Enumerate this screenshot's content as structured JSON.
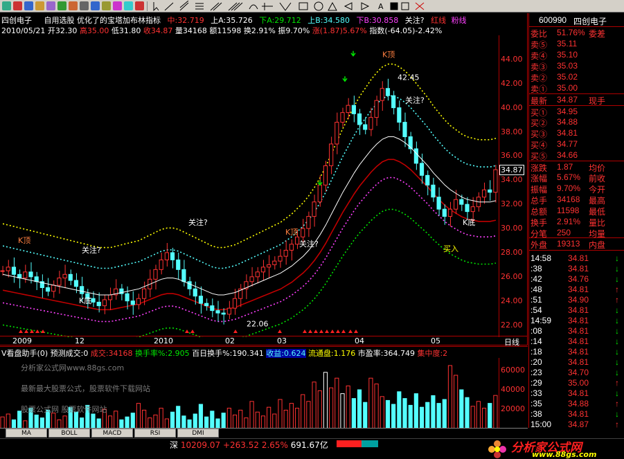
{
  "header": {
    "stock_name": "四创电子",
    "formula_line": "自用选股 优化了的宝塔加布林指标",
    "mid": "中:32.719",
    "upA": "上A:35.726",
    "downA": "下A:29.712",
    "upB": "上B:34.580",
    "downB": "下B:30.858",
    "focus": "关注?",
    "red_line": "红线",
    "pink_line": "粉线"
  },
  "info_line": {
    "date": "2010/05/21",
    "open": "开32.30",
    "high": "高35.00",
    "low": "低31.80",
    "close": "收34.87",
    "volume": "量34168",
    "amount": "额11598",
    "turnover": "换2.91%",
    "amplitude": "振9.70%",
    "change": "涨(1.87)5.67%",
    "index": "指数(-64.05)-2.42%"
  },
  "price_axis": [
    "44.00",
    "42.00",
    "40.00",
    "38.00",
    "36.00",
    "34.00",
    "32.00",
    "30.00",
    "28.00",
    "26.00",
    "24.00",
    "22.00"
  ],
  "price_current": "34.87",
  "date_axis": [
    "2009",
    "12",
    "2010",
    "02",
    "03",
    "04",
    "05"
  ],
  "date_axis_unit": "日线",
  "chart_labels": {
    "guanzhu": "关注?",
    "kdi": "K底",
    "kding": "K顶",
    "mairu": "买入",
    "low_mark": "22.06",
    "high_mark": "42.45"
  },
  "indicator_header": {
    "name": "V看盘助手(0)",
    "forecast": "预测成交:0",
    "volume": "成交:34168",
    "turnover": "换手率%:2.905",
    "turnover100": "百日换手%:190.341",
    "profit": "收益:0.624",
    "float": "流通盘:1.176",
    "pe": "市盈率:364.749",
    "conc": "集中度:2"
  },
  "volume_axis": [
    "60000",
    "40000",
    "20000"
  ],
  "watermarks": [
    "分析家公式网www.88gs.com",
    "最新最大股票公式，股票软件下载网站",
    "股票公式网 股票软件网站"
  ],
  "tabs": [
    "MA",
    "BOLL",
    "MACD",
    "RSI",
    "DMI"
  ],
  "status": {
    "market": "深",
    "index_value": "10209.07",
    "index_change": "+263.52",
    "index_pct": "2.65%",
    "turnover": "691.67亿"
  },
  "logo": {
    "text": "分析家公式网",
    "url": "www.88gs.com"
  },
  "right_panel": {
    "code": "600990",
    "name": "四创电子",
    "weibi_label": "委比",
    "weibi_value": "51.76%",
    "weicha_label": "委差",
    "sell": [
      {
        "label": "卖⑤",
        "price": "35.11"
      },
      {
        "label": "卖④",
        "price": "35.10"
      },
      {
        "label": "卖③",
        "price": "35.03"
      },
      {
        "label": "卖②",
        "price": "35.02"
      },
      {
        "label": "卖①",
        "price": "35.00"
      }
    ],
    "latest_label": "最新",
    "latest_value": "34.87",
    "xianshou": "现手",
    "buy": [
      {
        "label": "买①",
        "price": "34.95"
      },
      {
        "label": "买②",
        "price": "34.88"
      },
      {
        "label": "买③",
        "price": "34.81"
      },
      {
        "label": "买④",
        "price": "34.77"
      },
      {
        "label": "买⑤",
        "price": "34.66"
      }
    ],
    "stats": [
      {
        "l": "涨跌",
        "v": "1.87",
        "r": "均价"
      },
      {
        "l": "涨幅",
        "v": "5.67%",
        "r": "前收"
      },
      {
        "l": "振幅",
        "v": "9.70%",
        "r": "今开"
      },
      {
        "l": "总手",
        "v": "34168",
        "r": "最高"
      },
      {
        "l": "总额",
        "v": "11598",
        "r": "最低"
      },
      {
        "l": "换手",
        "v": "2.91%",
        "r": "量比"
      },
      {
        "l": "分笔",
        "v": "250",
        "r": "均量"
      }
    ],
    "waipan_label": "外盘",
    "waipan_value": "19313",
    "neipan_label": "内盘",
    "ticks": [
      {
        "t": "14:58",
        "p": "34.81",
        "d": "↓"
      },
      {
        "t": ":38",
        "p": "34.81",
        "d": "↓"
      },
      {
        "t": ":42",
        "p": "34.76",
        "d": "↓"
      },
      {
        "t": ":48",
        "p": "34.81",
        "d": "↑"
      },
      {
        "t": ":51",
        "p": "34.90",
        "d": "↑"
      },
      {
        "t": ":54",
        "p": "34.81",
        "d": "↓"
      },
      {
        "t": "14:59",
        "p": "34.81",
        "d": "↓"
      },
      {
        "t": ":08",
        "p": "34.81",
        "d": "↓"
      },
      {
        "t": ":14",
        "p": "34.81",
        "d": "↓"
      },
      {
        "t": ":18",
        "p": "34.81",
        "d": "↓"
      },
      {
        "t": ":20",
        "p": "34.81",
        "d": "↓"
      },
      {
        "t": ":23",
        "p": "34.70",
        "d": "↓"
      },
      {
        "t": ":29",
        "p": "35.00",
        "d": "↑"
      },
      {
        "t": ":33",
        "p": "34.81",
        "d": "↓"
      },
      {
        "t": ":35",
        "p": "34.88",
        "d": "↑"
      },
      {
        "t": ":38",
        "p": "34.81",
        "d": "↓"
      },
      {
        "t": "15:00",
        "p": "34.87",
        "d": "↑"
      }
    ]
  },
  "chart_data": {
    "type": "candlestick",
    "ylim": [
      21,
      46
    ],
    "close_series": [
      26.5,
      26.8,
      26.2,
      25.9,
      26.4,
      26.0,
      25.6,
      25.1,
      24.8,
      25.3,
      25.9,
      26.2,
      25.7,
      25.2,
      24.6,
      24.2,
      23.9,
      23.6,
      24.1,
      24.5,
      25.0,
      24.6,
      24.0,
      23.7,
      24.2,
      25.0,
      25.8,
      26.6,
      27.4,
      28.0,
      27.4,
      26.6,
      25.6,
      25.0,
      24.4,
      23.8,
      23.6,
      23.2,
      23.0,
      22.9,
      23.4,
      24.2,
      25.0,
      25.6,
      26.0,
      26.4,
      26.8,
      27.0,
      27.3,
      27.7,
      28.2,
      28.7,
      29.3,
      30.0,
      31.0,
      32.2,
      33.6,
      35.2,
      37.0,
      38.8,
      39.6,
      40.2,
      39.5,
      38.6,
      38.2,
      39.2,
      40.6,
      41.6,
      41.0,
      40.0,
      38.8,
      37.6,
      36.6,
      35.4,
      34.4,
      33.6,
      32.6,
      31.6,
      31.0,
      31.6,
      32.4,
      32.0,
      31.4,
      31.8,
      32.6,
      33.2,
      33.0,
      34.87
    ],
    "ma_series": [
      26.2,
      26.1,
      26.0,
      25.9,
      25.8,
      25.7,
      25.6,
      25.5,
      25.4,
      25.3,
      25.2,
      25.1,
      25.0,
      24.9,
      24.8,
      24.7,
      24.6,
      24.5,
      24.5,
      24.5,
      24.6,
      24.7,
      24.8,
      24.9,
      25.0,
      25.2,
      25.4,
      25.6,
      25.8,
      25.9,
      25.9,
      25.8,
      25.6,
      25.4,
      25.2,
      25.0,
      24.8,
      24.6,
      24.5,
      24.5,
      24.6,
      24.7,
      24.9,
      25.1,
      25.3,
      25.5,
      25.7,
      25.9,
      26.1,
      26.3,
      26.6,
      26.9,
      27.3,
      27.7,
      28.2,
      28.8,
      29.5,
      30.3,
      31.2,
      32.1,
      33.0,
      33.8,
      34.6,
      35.3,
      35.9,
      36.5,
      37.0,
      37.4,
      37.6,
      37.6,
      37.4,
      37.1,
      36.7,
      36.2,
      35.7,
      35.2,
      34.6,
      34.1,
      33.6,
      33.2,
      32.9,
      32.6,
      32.4,
      32.3,
      32.2,
      32.2,
      32.2,
      32.3
    ],
    "volume": [
      12000,
      15000,
      9000,
      18000,
      8000,
      21000,
      14000,
      11000,
      19000,
      16000,
      9000,
      13000,
      22000,
      17000,
      11000,
      24000,
      15000,
      10000,
      20000,
      13000,
      18000,
      9000,
      12000,
      16000,
      26000,
      19000,
      11000,
      14000,
      21000,
      10000,
      17000,
      23000,
      13000,
      9000,
      15000,
      25000,
      12000,
      18000,
      10000,
      16000,
      21000,
      14000,
      19000,
      11000,
      28000,
      17000,
      13000,
      22000,
      15000,
      30000,
      19000,
      26000,
      21000,
      35000,
      28000,
      48000,
      39000,
      58000,
      42000,
      52000,
      36000,
      44000,
      31000,
      40000,
      27000,
      52000,
      46000,
      33000,
      29000,
      25000,
      38000,
      31000,
      24000,
      36000,
      22000,
      27000,
      34000,
      26000,
      30000,
      65000,
      55000,
      40000,
      32000,
      23000,
      28000,
      21000,
      26000,
      34168
    ]
  }
}
